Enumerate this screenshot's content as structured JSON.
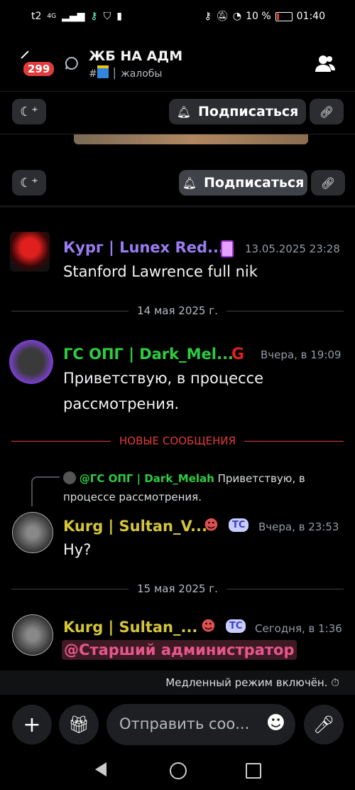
{
  "status": {
    "carrier": "t2",
    "network": "4G",
    "battery": "10 %",
    "time": "01:40"
  },
  "header": {
    "badge": "299",
    "title": "ЖБ НА АДМ",
    "channel_hash": "#",
    "channel": "жалобы"
  },
  "toolbar": {
    "subscribe": "Подписаться"
  },
  "messages": [
    {
      "name": "Кург | Lunex Red...",
      "time": "13.05.2025 23:28",
      "text": "Stanford Lawrence full nik",
      "name_color": "#9b7cf2"
    },
    {
      "name": "ГС ОПГ | Dark_Mel...",
      "time": "Вчера, в 19:09",
      "text1": "Приветствую, в процессе",
      "text2": "рассмотрения.",
      "name_color": "#2ecc40"
    },
    {
      "name": "Kurg | Sultan_V...",
      "time": "Вчера, в 23:53",
      "text": "Ну?",
      "badge": "ТС",
      "name_color": "#d4c53a"
    },
    {
      "name": "Kurg | Sultan_...",
      "time": "Сегодня, в 1:36",
      "mention": "@Старший администратор",
      "badge": "ТС",
      "name_color": "#d4c53a"
    }
  ],
  "reply": {
    "author": "@ГС ОПГ | Dark_Melah",
    "text1": "Приветствую, в",
    "text2": "процессе рассмотрения."
  },
  "dividers": {
    "d1": "14 мая 2025 г.",
    "new": "НОВЫЕ СООБЩЕНИЯ",
    "d2": "15 мая 2025 г."
  },
  "footer": {
    "slowmode": "Медленный режим включён.",
    "placeholder": "Отправить соо..."
  }
}
